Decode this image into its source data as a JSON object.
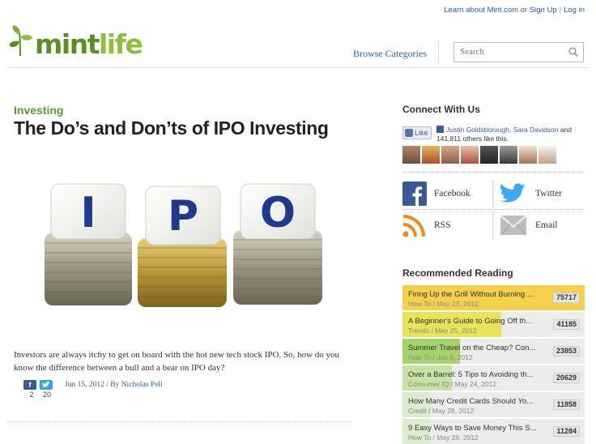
{
  "top_links": {
    "learn": "Learn about Mint.com",
    "or": "or",
    "signup": "Sign Up",
    "login": "Log in"
  },
  "logo": {
    "mint": "mint",
    "life": "life"
  },
  "nav": {
    "browse": "Browse Categories"
  },
  "search": {
    "placeholder": "Search"
  },
  "article": {
    "category": "Investing",
    "title": "The Do’s and Don’ts of IPO Investing",
    "image_letters": [
      "I",
      "P",
      "O"
    ],
    "excerpt": "Investors are always itchy to get on board with the hot new tech stock IPO. So, how do you know the difference between a bull and a bear on IPO day?",
    "share_counts": {
      "facebook": "2",
      "twitter": "20"
    },
    "date": "Jun 15, 2012 / By",
    "author": "Nicholas Pell"
  },
  "sidebar": {
    "connect_heading": "Connect With Us",
    "like_label": "Like",
    "fb_names": "Justin Goldsborough, Sara Davidson",
    "fb_rest": "and 141,811 others like this.",
    "social": {
      "facebook": "Facebook",
      "twitter": "Twitter",
      "rss": "RSS",
      "email": "Email"
    },
    "recommended_heading": "Recommended Reading",
    "recommended": [
      {
        "title": "Firing Up the Grill Without Burning ...",
        "meta": "How To / May 23, 2012",
        "count": "75717",
        "fill": 1.0,
        "color": "#f6cf4c"
      },
      {
        "title": "A Beginner's Guide to Going Off th...",
        "meta": "Trends / May 25, 2012",
        "count": "41185",
        "fill": 0.544,
        "color": "#e8e45a"
      },
      {
        "title": "Summer Travel on the Cheap? Con...",
        "meta": "How To / Jun 5, 2012",
        "count": "23853",
        "fill": 0.315,
        "color": "#a6d36b"
      },
      {
        "title": "Over a Barrel: 5 Tips to Avoiding th...",
        "meta": "Consumer IQ / May 24, 2012",
        "count": "20629",
        "fill": 0.272,
        "color": "#c6e3a6"
      },
      {
        "title": "How Many Credit Cards Should Yo...",
        "meta": "Credit / May 28, 2012",
        "count": "11858",
        "fill": 0.157,
        "color": "#dcecd0"
      },
      {
        "title": "9 Easy Ways to Save Money This S...",
        "meta": "How To / May 28, 2012",
        "count": "11284",
        "fill": 0.149,
        "color": "#dcecd0"
      }
    ]
  }
}
